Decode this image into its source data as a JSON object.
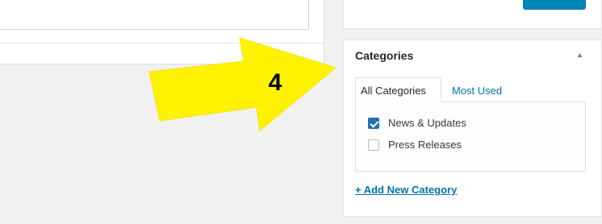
{
  "annotation": {
    "step_number": "4",
    "arrow_color": "#fff200"
  },
  "categories_box": {
    "title": "Categories",
    "toggle_icon": "triangle-up-icon",
    "tabs": [
      {
        "label": "All Categories",
        "active": true
      },
      {
        "label": "Most Used",
        "active": false
      }
    ],
    "items": [
      {
        "label": "News & Updates",
        "checked": true
      },
      {
        "label": "Press Releases",
        "checked": false
      }
    ],
    "add_link": "+ Add New Category"
  },
  "colors": {
    "link": "#0073aa",
    "checkbox_checked": "#2271b1",
    "background": "#f1f1f1"
  }
}
